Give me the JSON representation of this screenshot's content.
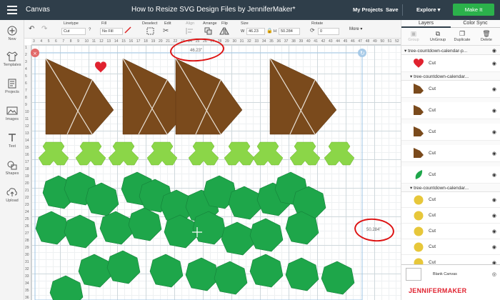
{
  "topbar": {
    "app_title": "Canvas",
    "doc_title": "How to Resize SVG Design Files by JenniferMaker*",
    "my_projects": "My Projects",
    "save": "Save",
    "machine": "Explore",
    "make_it": "Make It"
  },
  "left_tools": [
    {
      "label": "New",
      "icon": "plus-icon"
    },
    {
      "label": "Templates",
      "icon": "shirt-icon"
    },
    {
      "label": "Projects",
      "icon": "projects-icon"
    },
    {
      "label": "Images",
      "icon": "images-icon"
    },
    {
      "label": "Text",
      "icon": "text-icon"
    },
    {
      "label": "Shapes",
      "icon": "shapes-icon"
    },
    {
      "label": "Upload",
      "icon": "upload-icon"
    }
  ],
  "edit_toolbar": {
    "linetype_label": "Linetype",
    "linetype_value": "Cut",
    "fill_label": "Fill",
    "fill_value": "No Fill",
    "deselect_label": "Deselect",
    "edit_label": "Edit",
    "align_label": "Align",
    "arrange_label": "Arrange",
    "flip_label": "Flip",
    "size_label": "Size",
    "width_prefix": "W",
    "width_value": "46.23",
    "height_prefix": "H",
    "height_value": "50.284",
    "rotate_label": "Rotate",
    "rotate_value": "0",
    "more_label": "More"
  },
  "canvas": {
    "ruler_top": [
      "3",
      "4",
      "5",
      "6",
      "7",
      "8",
      "9",
      "10",
      "11",
      "12",
      "13",
      "14",
      "15",
      "16",
      "17",
      "18",
      "19",
      "20",
      "21",
      "22",
      "23",
      "24",
      "25",
      "26",
      "27",
      "28",
      "29",
      "30",
      "31",
      "32",
      "33",
      "34",
      "35",
      "36",
      "37",
      "38",
      "39",
      "40",
      "41",
      "42",
      "43",
      "44",
      "45",
      "46",
      "47",
      "48",
      "49",
      "50",
      "51",
      "52"
    ],
    "ruler_left": [
      "1",
      "2",
      "3",
      "4",
      "5",
      "6",
      "7",
      "8",
      "9",
      "10",
      "11",
      "12",
      "13",
      "14",
      "15",
      "16",
      "17",
      "18",
      "19",
      "20",
      "21",
      "22",
      "23",
      "24",
      "25",
      "26",
      "27",
      "28",
      "29",
      "30",
      "31",
      "32",
      "33",
      "34",
      "35",
      "36"
    ],
    "width_readout": "46.23\"",
    "height_readout": "50.284\""
  },
  "panel": {
    "tabs": [
      "Layers",
      "Color Sync"
    ],
    "actions": [
      {
        "label": "Group",
        "icon": "group-icon",
        "enabled": false
      },
      {
        "label": "UnGroup",
        "icon": "ungroup-icon",
        "enabled": true
      },
      {
        "label": "Duplicate",
        "icon": "duplicate-icon",
        "enabled": true
      },
      {
        "label": "Delete",
        "icon": "delete-icon",
        "enabled": true
      }
    ],
    "top_group": "tree-countdown-calendar-p...",
    "heart_label": "Cut",
    "sub_group_1": "tree-countdown-calendar...",
    "brown_items": [
      "Cut",
      "Cut",
      "Cut",
      "Cut"
    ],
    "leaf_item": "Cut",
    "sub_group_2": "tree-countdown-calendar...",
    "yellow_items": [
      "Cut",
      "Cut",
      "Cut",
      "Cut",
      "Cut"
    ],
    "blank_canvas": "Blank Canvas",
    "brand": "JENNIFERMAKER"
  },
  "colors": {
    "topbar": "#2f3e4a",
    "make_it": "#2bb14b",
    "brown": "#7a4a1c",
    "light_green": "#8bd648",
    "dark_green": "#1ea64a",
    "heart": "#e0222f",
    "yellow": "#e7c73a",
    "annotation_red": "#dd1111"
  }
}
